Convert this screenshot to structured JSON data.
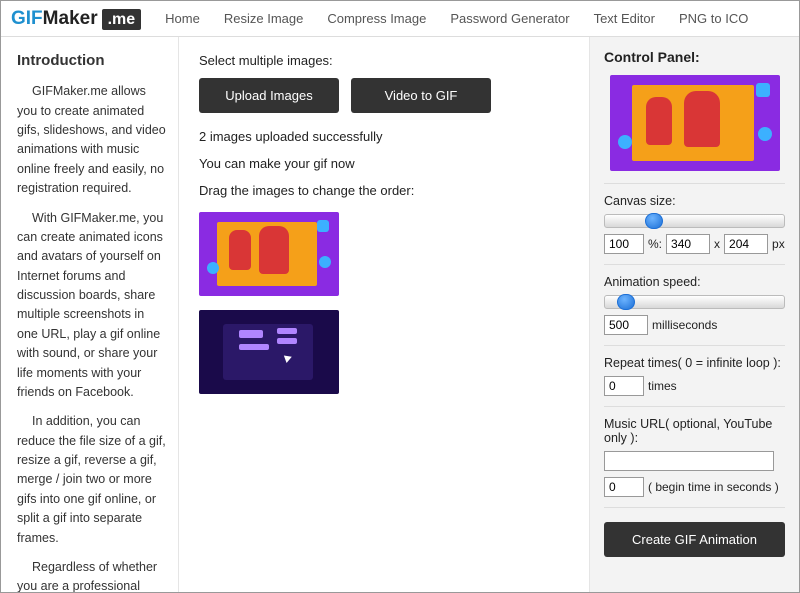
{
  "logo": {
    "gif": "GIF",
    "maker": "Maker",
    "me": ".me"
  },
  "nav": {
    "home": "Home",
    "resize": "Resize Image",
    "compress": "Compress Image",
    "pwd": "Password Generator",
    "text": "Text Editor",
    "png": "PNG to ICO"
  },
  "intro": {
    "title": "Introduction",
    "p1": "GIFMaker.me allows you to create animated gifs, slideshows, and video animations with music online freely and easily, no registration required.",
    "p2": "With GIFMaker.me, you can create animated icons and avatars of yourself on Internet forums and discussion boards, share multiple screenshots in one URL, play a gif online with sound, or share your life moments with your friends on Facebook.",
    "p3": "In addition, you can reduce the file size of a gif, resize a gif, reverse a gif, merge / join two or more gifs into one gif online, or split a gif into separate frames.",
    "p4": "Regardless of whether you are a professional"
  },
  "mid": {
    "select": "Select multiple images:",
    "upload": "Upload Images",
    "video": "Video to GIF",
    "uploaded": "2 images uploaded successfully",
    "make": "You can make your gif now",
    "drag": "Drag the images to change the order:"
  },
  "cp": {
    "title": "Control Panel:",
    "canvas": "Canvas size:",
    "percent": "100",
    "pct_suffix": "%:",
    "w": "340",
    "x": "x",
    "h": "204",
    "px": "px",
    "speed": "Animation speed:",
    "ms": "500",
    "ms_suffix": "milliseconds",
    "repeat": "Repeat times( 0 = infinite loop ):",
    "repeat_val": "0",
    "repeat_suffix": "times",
    "music": "Music URL( optional, YouTube only ):",
    "music_val": "",
    "begin": "0",
    "begin_suffix": "( begin time in seconds )",
    "create": "Create GIF Animation"
  }
}
